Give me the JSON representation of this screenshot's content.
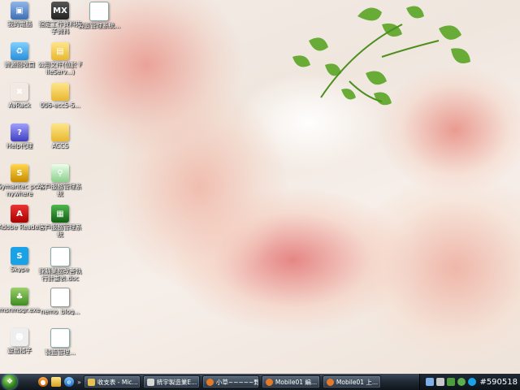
{
  "desktop": {
    "icons": [
      {
        "label": "我的電腦",
        "icon": "computer-icon"
      },
      {
        "label": "資源回收筒",
        "icon": "recycle-bin-icon"
      },
      {
        "label": "AvRack",
        "icon": "avrack-icon"
      },
      {
        "label": "Help代理",
        "icon": "help-agent-icon"
      },
      {
        "label": "Symantec pcAnywhere",
        "icon": "symantec-icon"
      },
      {
        "label": "Adobe Reader",
        "icon": "adobe-reader-icon"
      },
      {
        "label": "Skype",
        "icon": "skype-icon"
      },
      {
        "label": "msnmsgr.exe",
        "icon": "messenger-icon"
      },
      {
        "label": "遊戲橘子",
        "icon": "game-icon"
      },
      {
        "label": "指定工作資料夾子資料",
        "icon": "mx-icon"
      },
      {
        "label": "製造管理系統...",
        "icon": "document-icon"
      },
      {
        "label": "公用文件(位於 FileServ...)",
        "icon": "shared-folder-icon"
      },
      {
        "label": "006-ecc5-S...",
        "icon": "folder-icon"
      },
      {
        "label": "ACCS",
        "icon": "folder-icon"
      },
      {
        "label": "客戶服務管理系統",
        "icon": "web-app-icon"
      },
      {
        "label": "客戶服務管理系統",
        "icon": "green-app-icon"
      },
      {
        "label": "採購業務改善執行計畫表.doc",
        "icon": "document-icon"
      },
      {
        "label": "nemo_blog...",
        "icon": "text-file-icon"
      },
      {
        "label": "製造管理...",
        "icon": "document-icon"
      }
    ]
  },
  "taskbar": {
    "tasks": [
      {
        "label": "收支表 - Mic..."
      },
      {
        "label": "統宇製造業E..."
      },
      {
        "label": "小草~~~~~野..."
      },
      {
        "label": "Mobile01 編..."
      },
      {
        "label": "Mobile01 上..."
      }
    ],
    "clock": "#590518"
  },
  "colors": {
    "taskbar": "#1f2833",
    "task_active": "#5a6878"
  }
}
